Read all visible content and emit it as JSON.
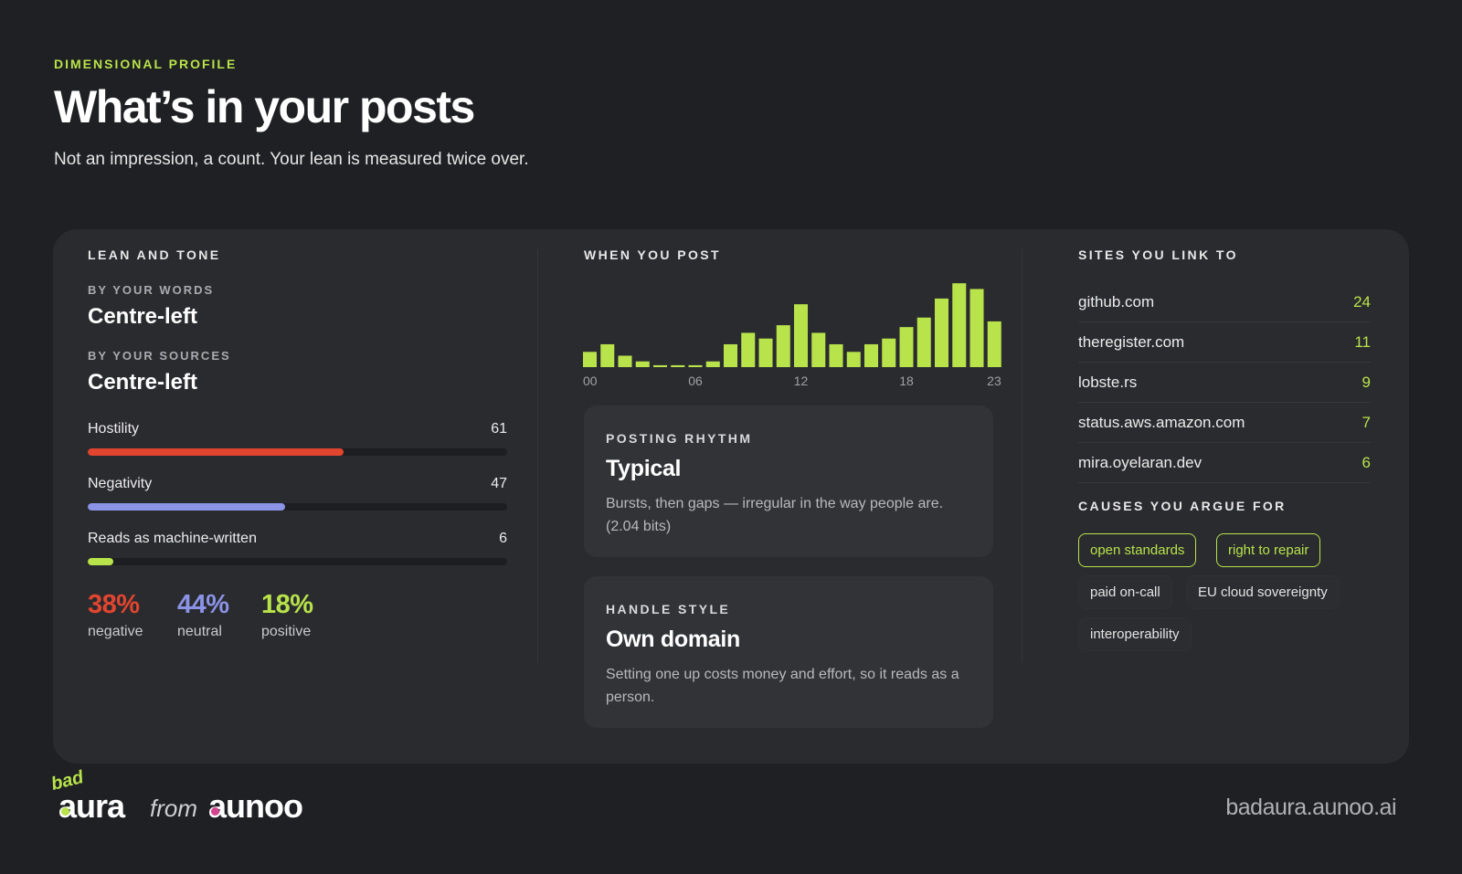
{
  "header": {
    "eyebrow": "DIMENSIONAL PROFILE",
    "title": "What’s in your posts",
    "subtitle": "Not an impression, a count. Your lean is measured twice over."
  },
  "lean": {
    "heading": "LEAN AND TONE",
    "words_label": "BY YOUR WORDS",
    "words_value": "Centre-left",
    "sources_label": "BY YOUR SOURCES",
    "sources_value": "Centre-left",
    "metrics": [
      {
        "label": "Hostility",
        "value": "61",
        "fraction": 0.61,
        "color": "#e2452f"
      },
      {
        "label": "Negativity",
        "value": "47",
        "fraction": 0.47,
        "color": "#8b93e6"
      },
      {
        "label": "Reads as machine-written",
        "value": "6",
        "fraction": 0.06,
        "color": "#b8e34a"
      }
    ],
    "tone": [
      {
        "pct": "38%",
        "label": "negative",
        "color": "#e2452f"
      },
      {
        "pct": "44%",
        "label": "neutral",
        "color": "#8b93e6"
      },
      {
        "pct": "18%",
        "label": "positive",
        "color": "#b8e34a"
      }
    ]
  },
  "when": {
    "heading": "WHEN YOU POST",
    "chart_data": {
      "type": "bar",
      "categories": [
        "00",
        "01",
        "02",
        "03",
        "04",
        "05",
        "06",
        "07",
        "08",
        "09",
        "10",
        "11",
        "12",
        "13",
        "14",
        "15",
        "16",
        "17",
        "18",
        "19",
        "20",
        "21",
        "22",
        "23"
      ],
      "tick_labels": [
        "00",
        "06",
        "12",
        "18",
        "23"
      ],
      "values": [
        8,
        12,
        6,
        3,
        1,
        1,
        1,
        3,
        12,
        18,
        15,
        22,
        33,
        18,
        12,
        8,
        12,
        15,
        21,
        26,
        36,
        44,
        41,
        24
      ],
      "ylim": [
        0,
        46
      ],
      "color": "#b8e34a"
    },
    "rhythm": {
      "heading": "POSTING RHYTHM",
      "title": "Typical",
      "body": "Bursts, then gaps — irregular in the way people are. (2.04 bits)"
    },
    "handle": {
      "heading": "HANDLE STYLE",
      "title": "Own domain",
      "body": "Setting one up costs money and effort, so it reads as a person."
    }
  },
  "sites": {
    "heading": "SITES YOU LINK TO",
    "items": [
      {
        "name": "github.com",
        "count": "24"
      },
      {
        "name": "theregister.com",
        "count": "11"
      },
      {
        "name": "lobste.rs",
        "count": "9"
      },
      {
        "name": "status.aws.amazon.com",
        "count": "7"
      },
      {
        "name": "mira.oyelaran.dev",
        "count": "6"
      }
    ]
  },
  "causes": {
    "heading": "CAUSES YOU ARGUE FOR",
    "tags": [
      {
        "label": "open standards",
        "highlighted": true
      },
      {
        "label": "right to repair",
        "highlighted": true
      },
      {
        "label": "paid on-call",
        "highlighted": false
      },
      {
        "label": "EU cloud sovereignty",
        "highlighted": false
      },
      {
        "label": "interoperability",
        "highlighted": false
      }
    ]
  },
  "footer": {
    "logo_bad": "bad",
    "logo_aura": "aura",
    "logo_from": "from",
    "logo_aunoo": "aunoo",
    "url": "badaura.aunoo.ai"
  },
  "colors": {
    "accent": "#b8e34a",
    "background": "#1f2023",
    "card": "#2a2b2f"
  }
}
